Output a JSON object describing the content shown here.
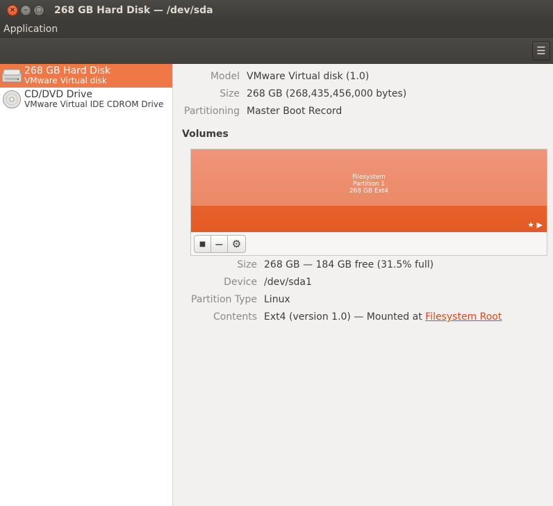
{
  "window": {
    "title": "268 GB Hard Disk — /dev/sda",
    "close_glyph": "×",
    "minimize_glyph": "–",
    "maximize_glyph": "□"
  },
  "menubar": {
    "application_label": "Application"
  },
  "toolbar": {
    "menu_icon": "hamburger-menu-icon"
  },
  "sidebar": {
    "items": [
      {
        "name": "268 GB Hard Disk",
        "subtitle": "VMware Virtual disk",
        "icon": "hard-disk-icon",
        "selected": true
      },
      {
        "name": "CD/DVD Drive",
        "subtitle": "VMware Virtual IDE CDROM Drive",
        "icon": "optical-disc-icon",
        "selected": false
      }
    ]
  },
  "disk": {
    "model_label": "Model",
    "model_value": "VMware Virtual disk (1.0)",
    "size_label": "Size",
    "size_value": "268 GB (268,435,456,000 bytes)",
    "partitioning_label": "Partitioning",
    "partitioning_value": "Master Boot Record"
  },
  "volumes": {
    "title": "Volumes",
    "segment": {
      "line1": "Filesystem",
      "line2": "Partition 1",
      "line3": "268 GB Ext4",
      "used_fraction": 0.315
    },
    "status_glyphs": "★ ▶"
  },
  "volume_details": {
    "size_label": "Size",
    "size_value": "268 GB — 184 GB free (31.5% full)",
    "device_label": "Device",
    "device_value": "/dev/sda1",
    "partition_type_label": "Partition Type",
    "partition_type_value": "Linux",
    "contents_label": "Contents",
    "contents_value": "Ext4 (version 1.0) — Mounted at ",
    "contents_link": "Filesystem Root"
  },
  "colors": {
    "accent": "#f07746",
    "link": "#dd4814",
    "titlebar": "#3c3b37"
  }
}
